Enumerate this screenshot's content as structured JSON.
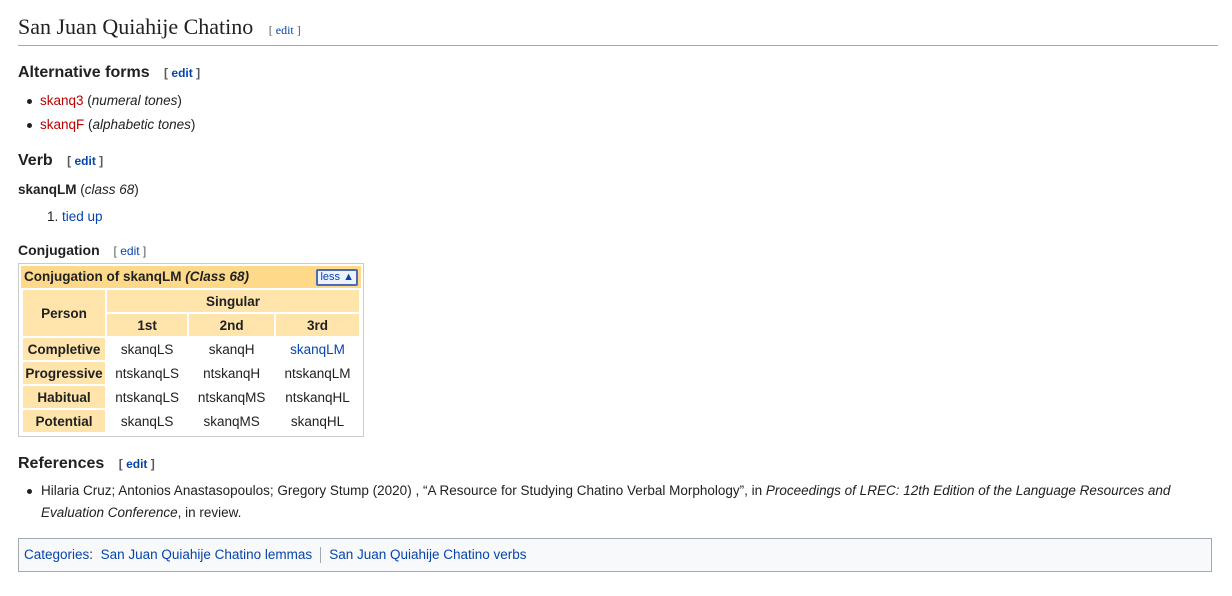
{
  "title": "San Juan Quiahije Chatino",
  "edit_label": "edit",
  "alt_forms": {
    "heading": "Alternative forms",
    "items": [
      {
        "form": "skanq3",
        "note": "numeral tones"
      },
      {
        "form": "skanqF",
        "note": "alphabetic tones"
      }
    ]
  },
  "verb": {
    "heading": "Verb",
    "headword": "skanqLM",
    "class_note": "class 68",
    "senses": [
      "tied up"
    ]
  },
  "conjugation": {
    "heading": "Conjugation",
    "table_title": "Conjugation of skanqLM",
    "table_class": "(Class 68)",
    "toggle_label": "less",
    "person_header": "Person",
    "singular_header": "Singular",
    "persons": [
      "1st",
      "2nd",
      "3rd"
    ],
    "rows": [
      {
        "label": "Completive",
        "cells": [
          "skanqLS",
          "skanqH",
          "skanqLM"
        ]
      },
      {
        "label": "Progressive",
        "cells": [
          "ntskanqLS",
          "ntskanqH",
          "ntskanqLM"
        ]
      },
      {
        "label": "Habitual",
        "cells": [
          "ntskanqLS",
          "ntskanqMS",
          "ntskanqHL"
        ]
      },
      {
        "label": "Potential",
        "cells": [
          "skanqLS",
          "skanqMS",
          "skanqHL"
        ]
      }
    ]
  },
  "references": {
    "heading": "References",
    "items": [
      {
        "authors": "Hilaria Cruz; Antonios Anastasopoulos; Gregory Stump (2020) , “A Resource for Studying Chatino Verbal Morphology”, in ",
        "venue": "Proceedings of LREC: 12th Edition of the Language Resources and Evaluation Conference",
        "tail": ", in review."
      }
    ]
  },
  "categories": {
    "label": "Categories",
    "items": [
      "San Juan Quiahije Chatino lemmas",
      "San Juan Quiahije Chatino verbs"
    ]
  },
  "colors": {
    "link": "#0645ad",
    "redlink": "#ba0000",
    "table_header": "#ffd98a",
    "table_cell_header": "#ffe4ab"
  }
}
